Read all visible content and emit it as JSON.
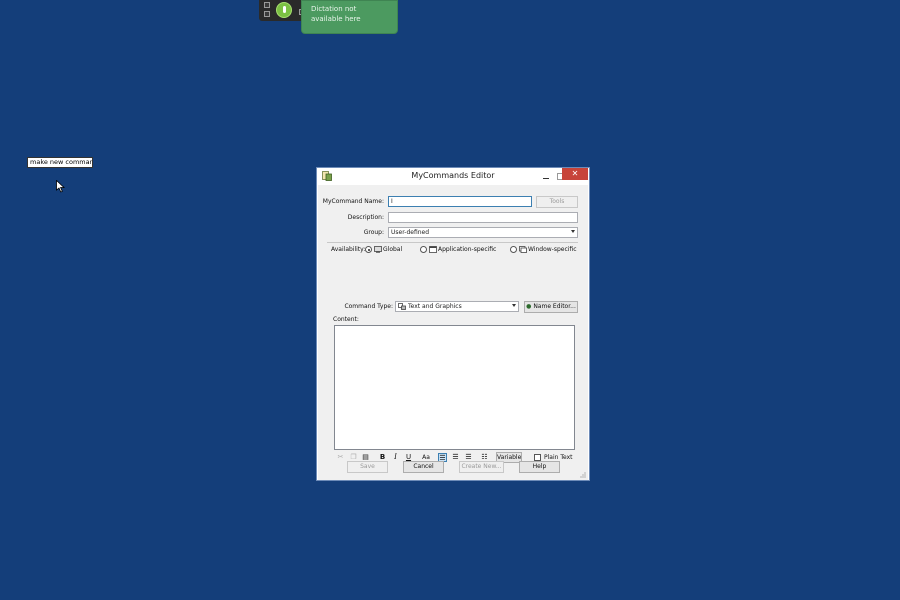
{
  "dictation": {
    "message": "Dictation not available here"
  },
  "floating_label": "make new command",
  "window": {
    "title": "MyCommands Editor",
    "close_glyph": "✕"
  },
  "form": {
    "name_label": "MyCommand Name:",
    "name_value": "I",
    "tools_button": "Tools",
    "description_label": "Description:",
    "description_value": "",
    "group_label": "Group:",
    "group_value": "User-defined",
    "availability_label": "Availability:",
    "availability_options": [
      "Global",
      "Application-specific",
      "Window-specific"
    ],
    "availability_selected": "Global",
    "command_type_label": "Command Type:",
    "command_type_value": "Text and Graphics",
    "name_editor_button": "Name Editor...",
    "content_label": "Content:"
  },
  "toolbar": {
    "bold": "B",
    "italic": "I",
    "underline": "U",
    "font": "Aa",
    "variable_button": "Variable",
    "plain_text_label": "Plain Text"
  },
  "buttons": {
    "save": "Save",
    "cancel": "Cancel",
    "create_new": "Create New...",
    "help": "Help"
  },
  "colors": {
    "desktop": "#143e7a",
    "dictation_tip": "#4c9a60",
    "close_button": "#c7443a"
  }
}
